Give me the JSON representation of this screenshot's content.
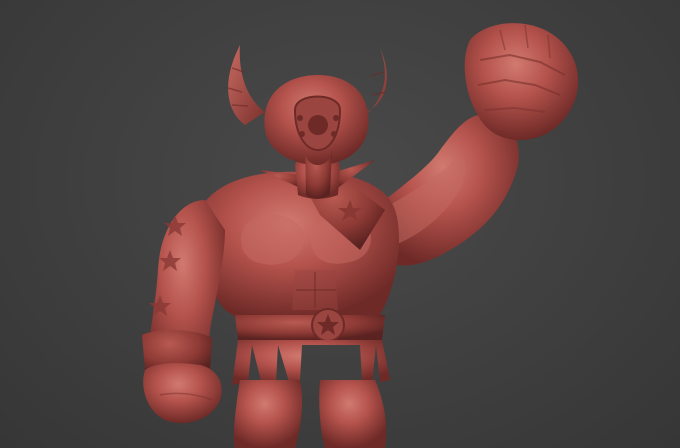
{
  "scene": {
    "background_color": "#424242",
    "model_color": "#b4524c",
    "model_shadow_color": "#6e2a27",
    "model_highlight_color": "#d97a72",
    "emblem": "star-icon"
  }
}
